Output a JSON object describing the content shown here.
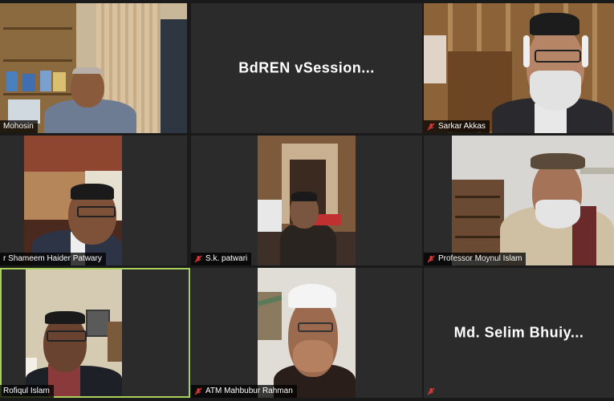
{
  "tiles": [
    {
      "name": "Mohosin",
      "display": "Mohosin",
      "muted": false
    },
    {
      "name": "BdREN vSession...",
      "muted": false
    },
    {
      "name": "Sarkar Akkas",
      "muted": true
    },
    {
      "name": "Shameem Haider Patwary",
      "display": "r Shameem Haider Patwary",
      "muted": false
    },
    {
      "name": "S.k. patwari",
      "muted": true
    },
    {
      "name": "Professor Moynul Islam",
      "muted": true
    },
    {
      "name": "Rofiqul Islam",
      "display": "Rofiqul Islam",
      "muted": false
    },
    {
      "name": "ATM Mahbubur Rahman",
      "muted": true
    },
    {
      "name": "Md. Selim Bhuiy...",
      "muted": true
    }
  ],
  "active_speaker": "Rofiqul Islam",
  "colors": {
    "background": "#1a1a1a",
    "tile": "#2b2b2b",
    "active_border": "#a8d05a",
    "mute_red": "#e03a3a"
  },
  "icons": {
    "mute": "microphone-muted-icon"
  }
}
